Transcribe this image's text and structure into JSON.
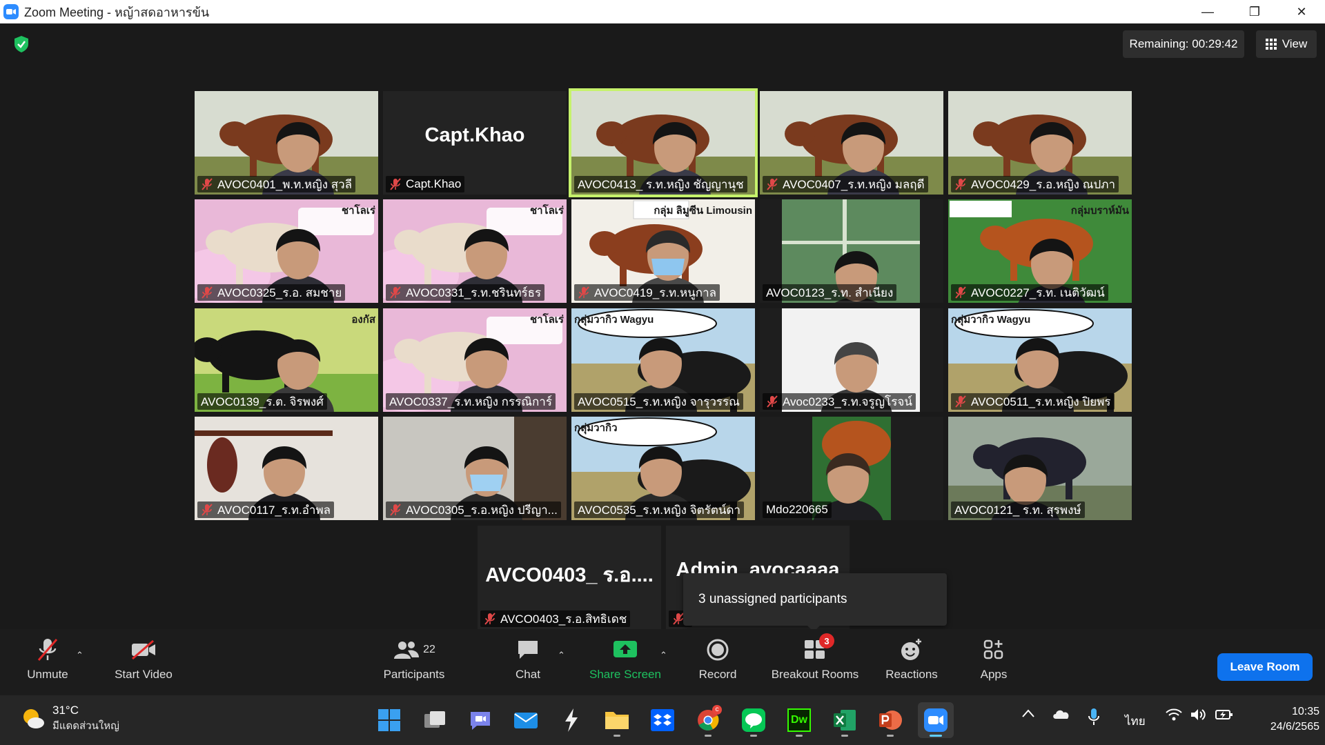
{
  "window": {
    "title": "Zoom Meeting - หญ้าสดอาหารข้น",
    "minimize_glyph": "—",
    "restore_glyph": "❐",
    "close_glyph": "✕"
  },
  "meeting": {
    "remaining": "Remaining: 00:29:42",
    "view_label": "View",
    "tooltip": "3 unassigned participants"
  },
  "tiles": [
    {
      "name": "AVOC0401_พ.ท.หญิง สุวลี",
      "muted": true,
      "scene": "cow-brown"
    },
    {
      "name": "Capt.Khao",
      "muted": true,
      "scene": "no-video",
      "big_name": "Capt.Khao"
    },
    {
      "name": "AVOC0413_ ร.ท.หญิง ชัญญานุช",
      "muted": false,
      "scene": "cow-brown",
      "active": true
    },
    {
      "name": "AVOC0407_ร.ท.หญิง มลฤดี",
      "muted": true,
      "scene": "cow-brown"
    },
    {
      "name": "AVOC0429_ร.อ.หญิง ณปภา",
      "muted": true,
      "scene": "cow-brown"
    },
    {
      "name": "AVOC0325_ร.อ. สมชาย",
      "muted": true,
      "scene": "charolais",
      "sign": "ชาโลเร่"
    },
    {
      "name": "AVOC0331_ร.ท.ชรินทร์ธร",
      "muted": true,
      "scene": "charolais",
      "sign": "ชาโลเร่"
    },
    {
      "name": "AVOC0419_ร.ท.หนูกาล",
      "muted": true,
      "scene": "limousin",
      "sign": "กลุ่ม ลิมูซีน Limousin"
    },
    {
      "name": "AVOC0123_ร.ท. สำเนียง",
      "muted": false,
      "scene": "room-green"
    },
    {
      "name": "AVOC0227_ร.ท. เนติวัฒน์",
      "muted": true,
      "scene": "brahman",
      "sign": "กลุ่มบราห์มัน"
    },
    {
      "name": "AVOC0139_ร.ต. จิรพงศ์",
      "muted": false,
      "scene": "angus",
      "sign": "องกัส"
    },
    {
      "name": "AVOC0337_ร.ท.หญิง กรรณิการ์",
      "muted": false,
      "scene": "charolais",
      "sign": "ชาโลเร่"
    },
    {
      "name": "AVOC0515_ร.ท.หญิง จารุวรรณ",
      "muted": false,
      "scene": "wagyu",
      "sign": "กลุ่มวากิว Wagyu"
    },
    {
      "name": "Avoc0233_ร.ท.จรูญโรจน์",
      "muted": true,
      "scene": "room-white"
    },
    {
      "name": "AVOC0511_ร.ท.หญิง ปิยพร",
      "muted": true,
      "scene": "wagyu",
      "sign": "กลุ่มวากิว Wagyu"
    },
    {
      "name": "AVOC0117_ร.ท.อำพล",
      "muted": true,
      "scene": "room-dark"
    },
    {
      "name": "AVOC0305_ร.อ.หญิง ปรีญา...",
      "muted": true,
      "scene": "office"
    },
    {
      "name": "AVOC0535_ร.ท.หญิง จิตรัตน์ดา",
      "muted": false,
      "scene": "wagyu",
      "sign": "กลุ่มวากิว"
    },
    {
      "name": "Mdo220665",
      "muted": false,
      "scene": "portrait"
    },
    {
      "name": "AVOC0121_ ร.ท. สุรพงษ์",
      "muted": false,
      "scene": "cow-black"
    },
    {
      "name": "AVCO0403_ร.อ.สิทธิเดช",
      "muted": true,
      "scene": "no-video",
      "big_name": "AVCO0403_ ร.อ...."
    },
    {
      "name": "",
      "muted": true,
      "scene": "no-video",
      "big_name": "Admin_avocaaaa"
    }
  ],
  "toolbar": {
    "unmute": "Unmute",
    "start_video": "Start Video",
    "participants": "Participants",
    "participants_count": "22",
    "chat": "Chat",
    "share_screen": "Share Screen",
    "record": "Record",
    "breakout_rooms": "Breakout Rooms",
    "breakout_badge": "3",
    "reactions": "Reactions",
    "apps": "Apps",
    "leave_room": "Leave Room"
  },
  "taskbar": {
    "temperature": "31°C",
    "weather_desc": "มีแดดส่วนใหญ่",
    "chrome_badge": "c",
    "dreamweaver_label": "Dw",
    "language": "ไทย",
    "time": "10:35",
    "date": "24/6/2565"
  },
  "colors": {
    "accent_blue": "#0e72ed",
    "share_green": "#1ec15f",
    "active_speaker": "#c6f26c",
    "badge_red": "#e02828"
  }
}
